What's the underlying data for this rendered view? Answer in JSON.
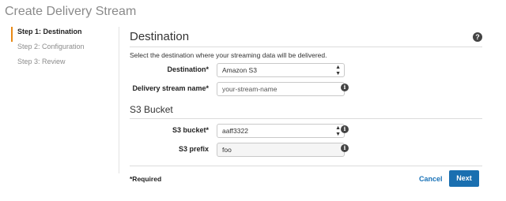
{
  "page": {
    "title": "Create Delivery Stream"
  },
  "steps": [
    {
      "label": "Step 1: Destination"
    },
    {
      "label": "Step 2: Configuration"
    },
    {
      "label": "Step 3: Review"
    }
  ],
  "destination_section": {
    "title": "Destination",
    "help_icon": "question-circle-icon",
    "description": "Select the destination where your streaming data will be delivered.",
    "destination": {
      "label": "Destination*",
      "value": "Amazon S3"
    },
    "stream_name": {
      "label": "Delivery stream name*",
      "placeholder": "your-stream-name"
    }
  },
  "s3_section": {
    "title": "S3 Bucket",
    "bucket": {
      "label": "S3 bucket*",
      "value": "aaff3322"
    },
    "prefix": {
      "label": "S3 prefix",
      "value": "foo"
    }
  },
  "footer": {
    "required_note": "*Required",
    "cancel_label": "Cancel",
    "next_label": "Next"
  },
  "colors": {
    "accent_orange": "#e98a16",
    "primary_blue": "#1a6fb0",
    "link_blue": "#1a73b8"
  },
  "icons": {
    "info": "info-icon",
    "select_arrows": "updown-arrows-icon"
  }
}
